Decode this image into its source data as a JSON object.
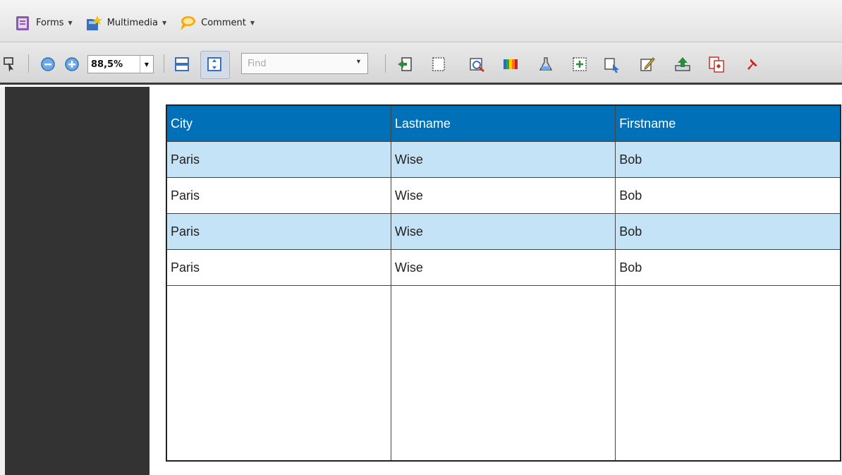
{
  "toolbar_top": {
    "forms": {
      "label": "Forms",
      "icon": "forms-icon"
    },
    "multimedia": {
      "label": "Multimedia",
      "icon": "multimedia-icon"
    },
    "comment": {
      "label": "Comment",
      "icon": "comment-icon"
    }
  },
  "toolbar_bottom": {
    "zoom_value": "88,5%",
    "find_placeholder": "Find",
    "tool_icons": [
      "select-object-icon",
      "zoom-out-icon",
      "zoom-in-icon",
      "fit-width-icon",
      "fit-page-icon",
      "export-icon",
      "crop-icon",
      "preflight-icon",
      "color-bars-icon",
      "ink-icon",
      "add-field-icon",
      "touch-up-object-icon",
      "edit-icon",
      "upload-icon",
      "pdf-convert-icon",
      "pin-icon"
    ]
  },
  "table": {
    "columns": [
      "City",
      "Lastname",
      "Firstname"
    ],
    "rows": [
      [
        "Paris",
        "Wise",
        "Bob"
      ],
      [
        "Paris",
        "Wise",
        "Bob"
      ],
      [
        "Paris",
        "Wise",
        "Bob"
      ],
      [
        "Paris",
        "Wise",
        "Bob"
      ]
    ]
  },
  "colors": {
    "header_bg": "#0070b9",
    "alt_row_bg": "#c5e3f6",
    "side_panel_bg": "#333333"
  }
}
